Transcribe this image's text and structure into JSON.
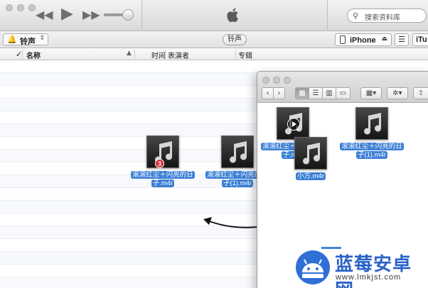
{
  "player": {
    "rewind_icon": "rewind-icon",
    "play_icon": "play-icon",
    "forward_icon": "fast-forward-icon",
    "volume_level": 0.75,
    "search_placeholder": "搜索资料库"
  },
  "toolbar": {
    "library_label": "铃声",
    "center_tab": "铃声",
    "device_label": "iPhone",
    "itunes_store_label": "iTu"
  },
  "columns": {
    "check": "✓",
    "name": "名称",
    "time": "时间",
    "artist": "表演者",
    "album": "专辑"
  },
  "dragged_files": [
    {
      "name": "滚滚红尘＋闪亮的日子.m4r",
      "badge": "3"
    },
    {
      "name": "滚滚红尘＋闪亮的日子(1).m4r"
    }
  ],
  "finder_files": [
    {
      "name": "滚滚红尘＋闪亮的日子.m4r"
    },
    {
      "name": "小方.m4r"
    },
    {
      "name": "滚滚红尘＋闪亮的日子(1).m4r"
    }
  ],
  "watermark": {
    "name": "蓝莓安卓网",
    "url": "www.lmkjst.com"
  },
  "colors": {
    "selection_blue": "#3b7fd5",
    "badge_red": "#d8292d",
    "brand_blue": "#2a62c8"
  }
}
